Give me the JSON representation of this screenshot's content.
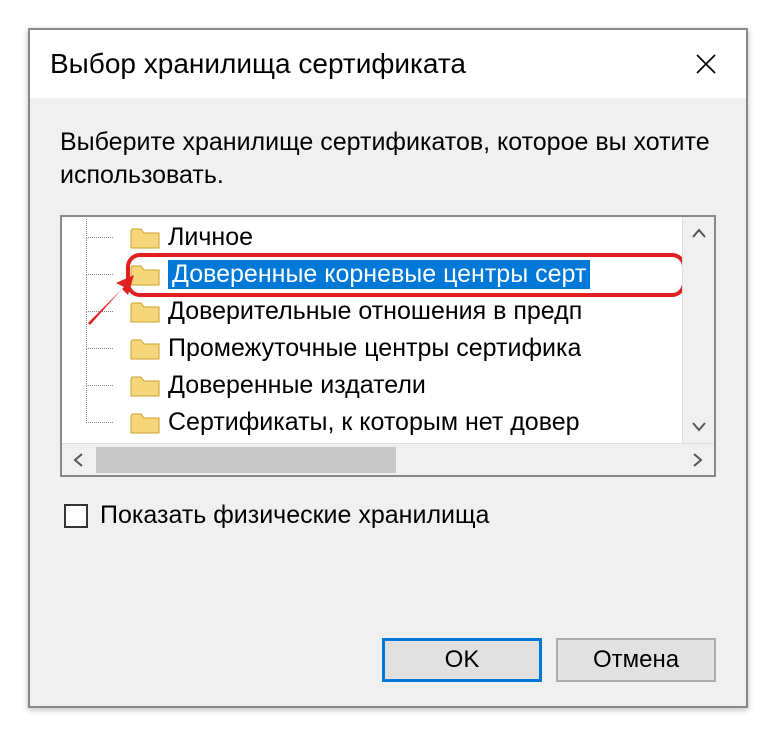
{
  "dialog": {
    "title": "Выбор хранилища сертификата",
    "instruction": "Выберите хранилище сертификатов, которое вы хотите использовать."
  },
  "tree": {
    "items": [
      {
        "label": "Личное",
        "selected": false
      },
      {
        "label": "Доверенные корневые центры серт",
        "selected": true
      },
      {
        "label": "Доверительные отношения в предп",
        "selected": false
      },
      {
        "label": "Промежуточные центры сертифика",
        "selected": false
      },
      {
        "label": "Доверенные издатели",
        "selected": false
      },
      {
        "label": "Сертификаты, к которым нет довер",
        "selected": false
      }
    ]
  },
  "checkbox": {
    "label": "Показать физические хранилища",
    "checked": false
  },
  "buttons": {
    "ok": "OK",
    "cancel": "Отмена"
  }
}
